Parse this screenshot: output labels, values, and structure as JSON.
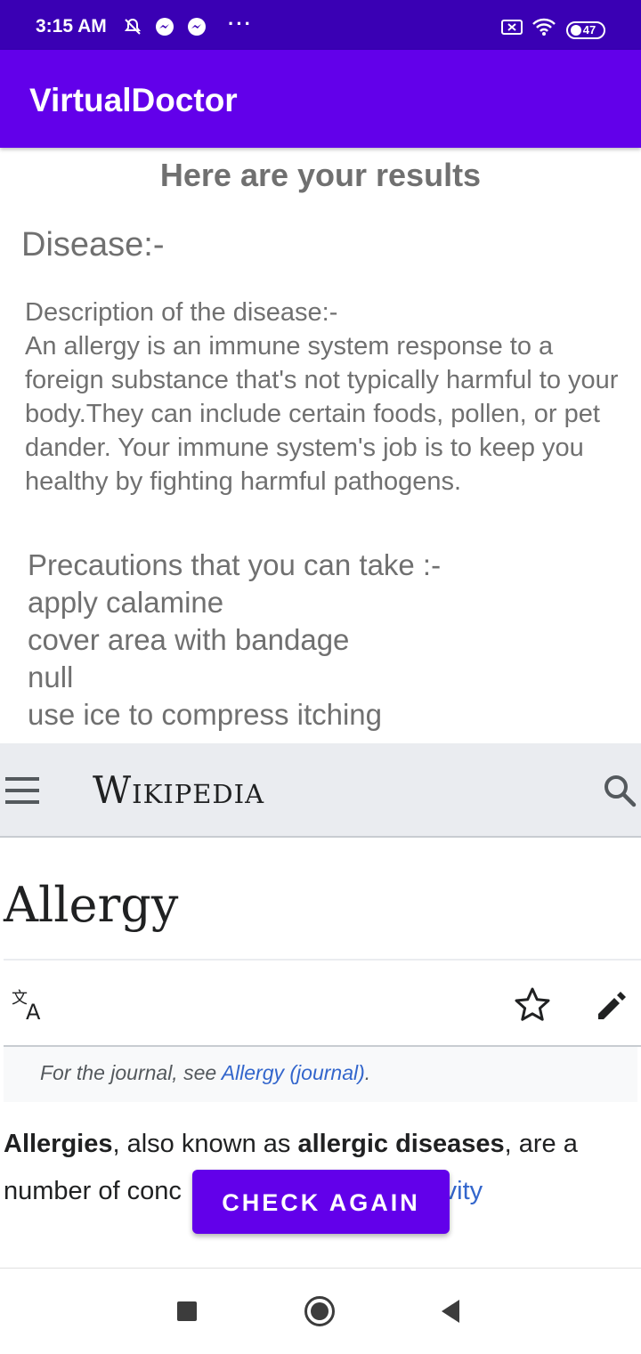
{
  "status_bar": {
    "time": "3:15 AM",
    "icons": [
      "notifications-off-icon",
      "messenger-icon",
      "messenger-icon",
      "sim-off-icon",
      "wifi-icon"
    ],
    "more": "···",
    "battery": "47"
  },
  "app_bar": {
    "title": "VirtualDoctor"
  },
  "results": {
    "heading": "Here are your results",
    "disease_label": "Disease:-",
    "description_label": "Description of the disease:-",
    "description_text": "An allergy is an immune system response to a foreign substance that's not typically harmful to your body.They can include certain foods, pollen, or pet dander. Your immune system's job is to keep you healthy by fighting harmful pathogens.",
    "precautions_label": "Precautions that you can take :-",
    "precautions": [
      "apply calamine",
      "cover area with bandage",
      "null",
      "use ice to compress itching"
    ]
  },
  "wikipedia": {
    "wordmark": "Wikipedia",
    "article_title": "Allergy",
    "hatnote_prefix": "For the journal, see ",
    "hatnote_link": "Allergy (journal)",
    "hatnote_suffix": ".",
    "para_bold1": "Allergies",
    "para_text1": ", also known as ",
    "para_bold2": "allergic diseases",
    "para_text2": ", are a number of conc",
    "para_link": "hypersensitivity"
  },
  "actions": {
    "check_again": "CHECK AGAIN"
  },
  "colors": {
    "primary": "#6200ea",
    "status_bar": "#3a00b4",
    "link": "#3366cc"
  }
}
